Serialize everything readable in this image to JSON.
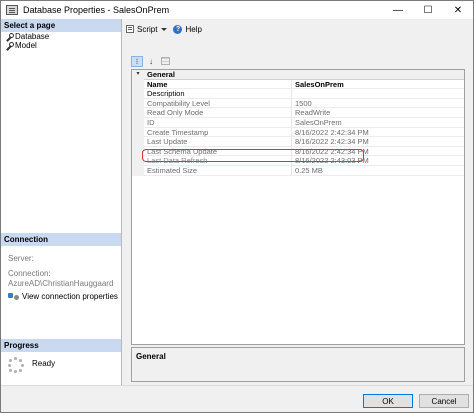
{
  "window": {
    "title": "Database Properties - SalesOnPrem",
    "minimize": "—",
    "maximize": "☐",
    "close": "✕"
  },
  "left": {
    "select_page_header": "Select a page",
    "pages": [
      {
        "label": "Database"
      },
      {
        "label": "Model"
      }
    ],
    "connection_header": "Connection",
    "server_label": "Server:",
    "connection_label": "Connection:",
    "connection_value": "AzureAD\\ChristianHauggaard",
    "view_connection_link": "View connection properties",
    "progress_header": "Progress",
    "progress_status": "Ready"
  },
  "toolbar": {
    "script_label": "Script",
    "help_label": "Help"
  },
  "grid": {
    "category": "General",
    "rows": [
      {
        "name": "Name",
        "value": "SalesOnPrem"
      },
      {
        "name": "Description",
        "value": ""
      },
      {
        "name": "Compatibility Level",
        "value": "1500"
      },
      {
        "name": "Read Only Mode",
        "value": "ReadWrite"
      },
      {
        "name": "ID",
        "value": "SalesOnPrem"
      },
      {
        "name": "Create Timestamp",
        "value": "8/16/2022 2:42:34 PM"
      },
      {
        "name": "Last Update",
        "value": "8/16/2022 2:42:34 PM"
      },
      {
        "name": "Last Schema Update",
        "value": "8/16/2022 2:42:34 PM"
      },
      {
        "name": "Last Data Refresh",
        "value": "8/16/2022 2:43:03 PM"
      },
      {
        "name": "Estimated Size",
        "value": "0.25 MB"
      }
    ]
  },
  "description_panel": {
    "title": "General"
  },
  "footer": {
    "ok_label": "OK",
    "cancel_label": "Cancel"
  },
  "colors": {
    "section_header_bg": "#c9daf0",
    "highlight_border": "#e0303c",
    "ok_border": "#0078d7"
  }
}
